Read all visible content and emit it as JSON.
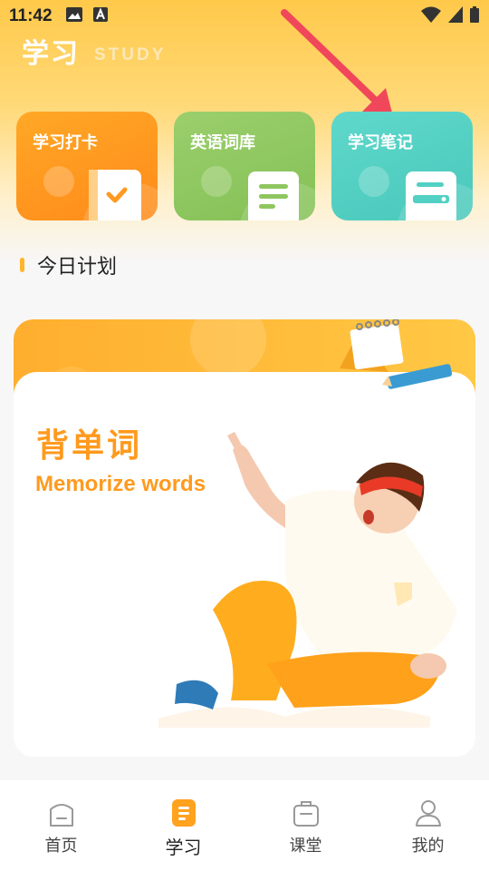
{
  "status": {
    "time": "11:42"
  },
  "header": {
    "title": "学习",
    "subtitle": "STUDY"
  },
  "cards": [
    {
      "label": "学习打卡",
      "color": "#ff9a20"
    },
    {
      "label": "英语词库",
      "color": "#8fc65f"
    },
    {
      "label": "学习笔记",
      "color": "#52d0c3"
    }
  ],
  "plan": {
    "title": "今日计划"
  },
  "banner": {
    "title": "背单词",
    "subtitle": "Memorize words"
  },
  "tabs": [
    {
      "label": "首页",
      "icon": "home-icon"
    },
    {
      "label": "学习",
      "icon": "study-icon",
      "active": true
    },
    {
      "label": "课堂",
      "icon": "classroom-icon"
    },
    {
      "label": "我的",
      "icon": "profile-icon"
    }
  ],
  "colors": {
    "accent": "#ff9a1e",
    "arrow": "#f0475a"
  }
}
